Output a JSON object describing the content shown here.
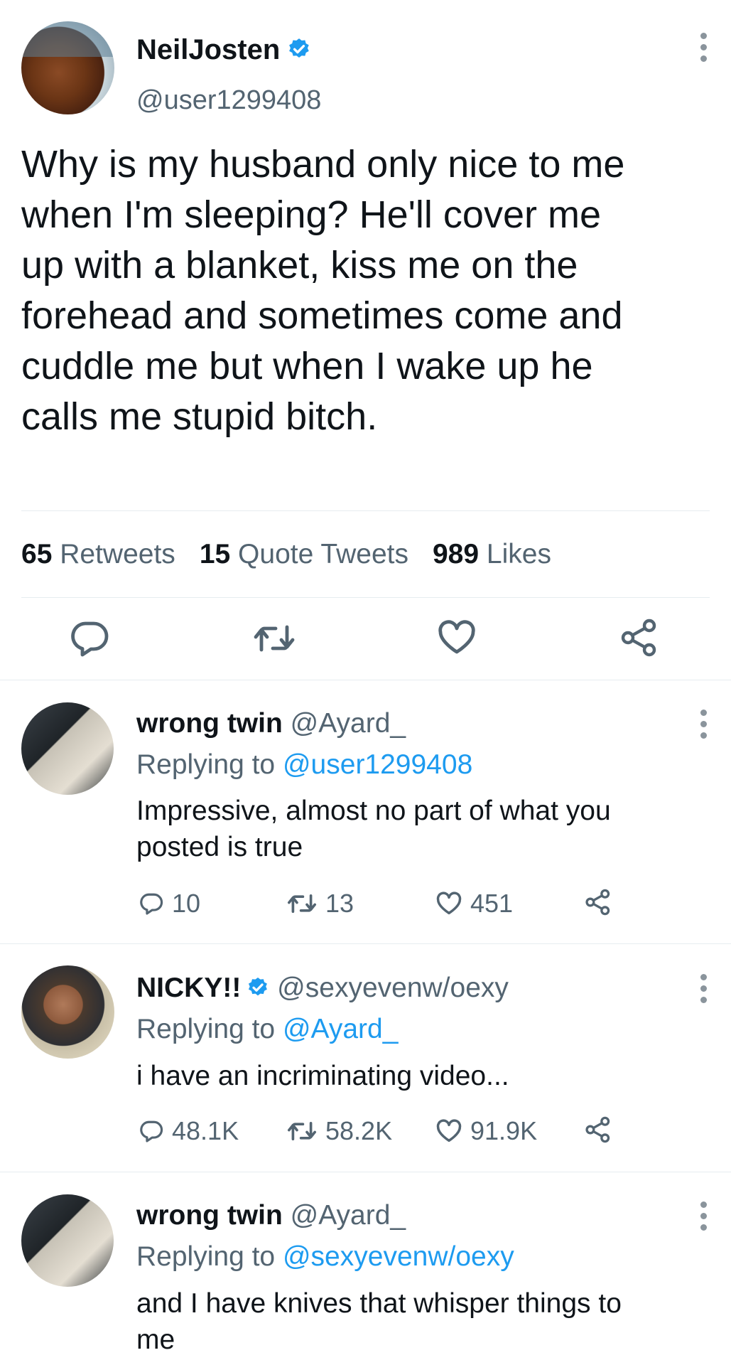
{
  "colors": {
    "accent": "#1d9bf0",
    "secondary_text": "#536471",
    "divider": "#e6ecf0",
    "icon": "#8a949c"
  },
  "main_tweet": {
    "display_name": "NeilJosten",
    "verified": true,
    "handle": "@user1299408",
    "text_lines": [
      "Why is my husband only nice to me",
      "when I'm sleeping? He'll cover me",
      "up with a blanket, kiss me on the",
      "forehead and sometimes come and",
      "cuddle me but when I wake up he",
      "calls me stupid bitch."
    ],
    "stats": {
      "retweets_count": "65",
      "retweets_label": "Retweets",
      "quotes_count": "15",
      "quotes_label": "Quote Tweets",
      "likes_count": "989",
      "likes_label": "Likes"
    },
    "actions": [
      "reply-icon",
      "retweet-icon",
      "like-icon",
      "share-icon"
    ]
  },
  "replies": [
    {
      "display_name": "wrong twin",
      "verified": false,
      "handle": "@Ayard_",
      "replying_label": "Replying to",
      "replying_to": "@user1299408",
      "text_lines": [
        "Impressive, almost no part of what you",
        "posted is true"
      ],
      "reply_count": "10",
      "retweet_count": "13",
      "like_count": "451"
    },
    {
      "display_name": "NICKY!!",
      "verified": true,
      "handle": "@sexyevenw/oexy",
      "replying_label": "Replying to",
      "replying_to": "@Ayard_",
      "text_lines": [
        "i have an incriminating video..."
      ],
      "reply_count": "48.1K",
      "retweet_count": "58.2K",
      "like_count": "91.9K"
    },
    {
      "display_name": "wrong twin",
      "verified": false,
      "handle": "@Ayard_",
      "replying_label": "Replying to",
      "replying_to": "@sexyevenw/oexy",
      "text_lines": [
        "and I have knives that whisper things to",
        "me"
      ]
    }
  ]
}
